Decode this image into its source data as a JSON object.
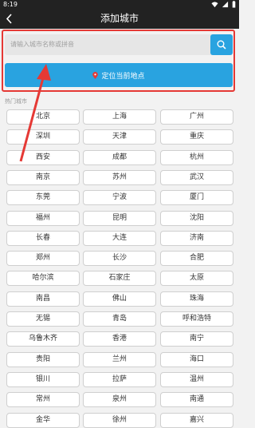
{
  "status_bar": {
    "time": "8:19"
  },
  "header": {
    "title": "添加城市"
  },
  "search": {
    "placeholder": "请输入城市名称或拼音"
  },
  "locate": {
    "label": "定位当前地点"
  },
  "hot": {
    "label": "热门城市"
  },
  "cities": [
    "北京",
    "上海",
    "广州",
    "深圳",
    "天津",
    "重庆",
    "西安",
    "成都",
    "杭州",
    "南京",
    "苏州",
    "武汉",
    "东莞",
    "宁波",
    "厦门",
    "福州",
    "昆明",
    "沈阳",
    "长春",
    "大连",
    "济南",
    "郑州",
    "长沙",
    "合肥",
    "哈尔滨",
    "石家庄",
    "太原",
    "南昌",
    "佛山",
    "珠海",
    "无锡",
    "青岛",
    "呼和浩特",
    "乌鲁木齐",
    "香港",
    "南宁",
    "贵阳",
    "兰州",
    "海口",
    "银川",
    "拉萨",
    "温州",
    "常州",
    "泉州",
    "南通",
    "金华",
    "徐州",
    "嘉兴"
  ],
  "colors": {
    "accent": "#29a3e0",
    "highlight": "#e53935",
    "topbar": "#222222"
  }
}
